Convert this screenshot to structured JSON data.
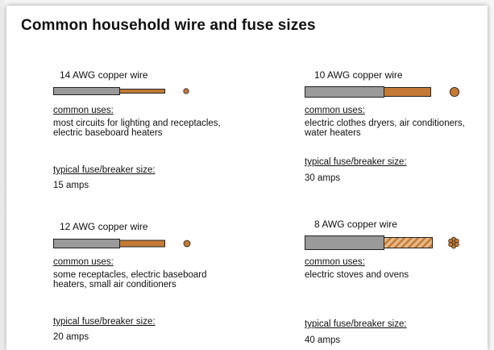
{
  "title": "Common household wire and fuse sizes",
  "colors": {
    "insulation": "#9a9a9a",
    "copper": "#c47a35",
    "copper_light": "#e6b98a",
    "outline": "#222222"
  },
  "wires": [
    {
      "label": "14 AWG copper wire",
      "uses_heading": "common uses:",
      "uses": "most circuits for lighting and receptacles, electric baseboard heaters",
      "fuse_heading": "typical fuse/breaker size:",
      "fuse_size": "15 amps",
      "conductor": "solid"
    },
    {
      "label": "10 AWG copper wire",
      "uses_heading": "common uses:",
      "uses": "electric clothes dryers, air conditioners, water heaters",
      "fuse_heading": "typical fuse/breaker size:",
      "fuse_size": "30 amps",
      "conductor": "solid"
    },
    {
      "label": "12 AWG copper wire",
      "uses_heading": "common uses:",
      "uses": "some receptacles, electric baseboard heaters, small air conditioners",
      "fuse_heading": "typical fuse/breaker size:",
      "fuse_size": "20 amps",
      "conductor": "solid"
    },
    {
      "label": "8 AWG copper wire",
      "uses_heading": "common uses:",
      "uses": "electric stoves and ovens",
      "fuse_heading": "typical fuse/breaker size:",
      "fuse_size": "40 amps",
      "conductor": "stranded"
    }
  ]
}
